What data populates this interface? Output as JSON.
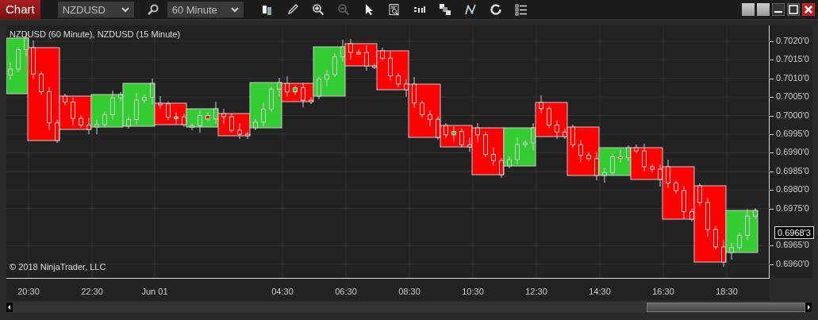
{
  "window": {
    "title": "Chart"
  },
  "toolbar": {
    "instrument": "NZDUSD",
    "interval": "60 Minute"
  },
  "chart": {
    "label": "NZDUSD (60 Minute), NZDUSD (15 Minute)",
    "copyright": "© 2018 NinjaTrader, LLC",
    "y_ticks": [
      "0.7020'0",
      "0.7015'0",
      "0.7010'0",
      "0.7005'0",
      "0.7000'0",
      "0.6995'0",
      "0.6990'0",
      "0.6985'0",
      "0.6980'0",
      "0.6975'0",
      "0.6965'0",
      "0.6960'0"
    ],
    "x_ticks": [
      "20:30",
      "22:30",
      "Jun 01",
      "04:30",
      "06:30",
      "08:30",
      "10:30",
      "12:30",
      "14:30",
      "16:30",
      "18:30"
    ],
    "last_price": "0.6968'3"
  }
}
